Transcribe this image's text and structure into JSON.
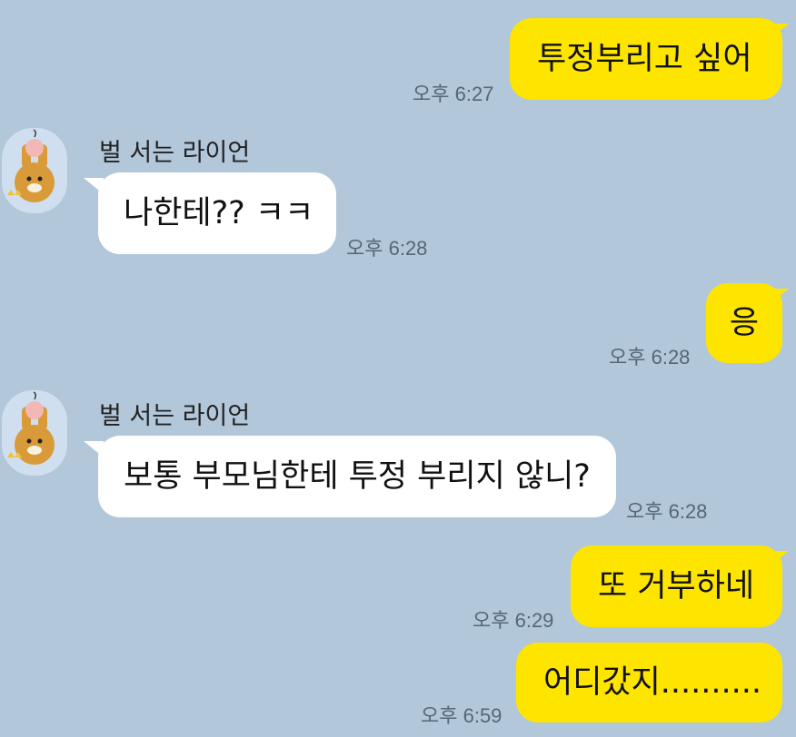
{
  "messages": [
    {
      "side": "mine",
      "text": "투정부리고 싶어",
      "time": "오후 6:27"
    },
    {
      "side": "theirs",
      "sender": "벌 서는 라이언",
      "avatar_icon": "ryan-punishment-icon",
      "text": "나한테?? ㅋㅋ",
      "time": "오후 6:28"
    },
    {
      "side": "mine",
      "text": "응",
      "time": "오후 6:28"
    },
    {
      "side": "theirs",
      "sender": "벌 서는 라이언",
      "avatar_icon": "ryan-punishment-icon",
      "text": "보통 부모님한테 투정 부리지 않니?",
      "time": "오후 6:28"
    },
    {
      "side": "mine",
      "text": "또 거부하네",
      "time": "오후 6:29"
    },
    {
      "side": "mine",
      "text": "어디갔지..........",
      "time": "오후 6:59"
    }
  ],
  "colors": {
    "background": "#b2c7d9",
    "my_bubble": "#fee500",
    "their_bubble": "#ffffff"
  }
}
